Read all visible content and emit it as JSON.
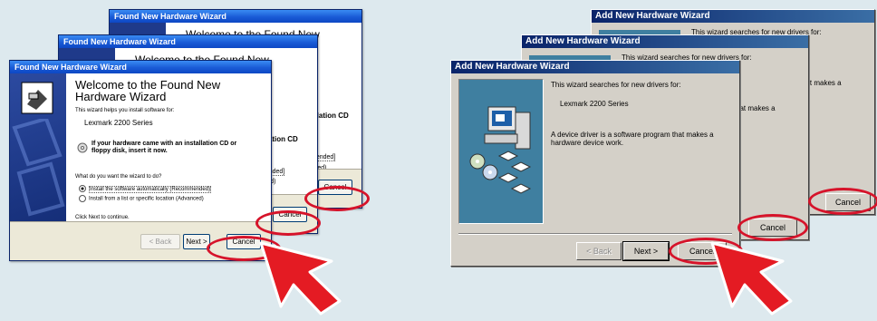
{
  "xp": {
    "title": "Found New Hardware Wizard",
    "back_title": "Welcome to the Found New",
    "welcome_heading": "Welcome to the Found New Hardware Wizard",
    "intro": "This wizard helps you install software for:",
    "device": "Lexmark 2200 Series",
    "cd_hint": "If your hardware came with an installation CD or floppy disk, insert it now.",
    "question": "What do you want the wizard to do?",
    "option_auto": "Install the software automatically (Recommended)",
    "option_list": "Install from a list or specific location (Advanced)",
    "continue": "Click Next to continue.",
    "back_btn": "< Back",
    "next_btn": "Next >",
    "cancel_btn": "Cancel",
    "frag_installation_cd": "allation CD",
    "frag_recommended": "mended]",
    "frag_advanced": "nced)"
  },
  "classic": {
    "title": "Add New Hardware Wizard",
    "search_text": "This wizard searches for new drivers for:",
    "device": "Lexmark 2200 Series",
    "desc": "A device driver is a software program that makes a hardware device work.",
    "frag_makes_a": "hat makes a",
    "back_btn": "< Back",
    "next_btn": "Next >",
    "cancel_btn": "Cancel"
  },
  "colors": {
    "highlight": "#d6132a",
    "xp_title": "#1a5bd6",
    "classic_title": "#0a246a"
  }
}
